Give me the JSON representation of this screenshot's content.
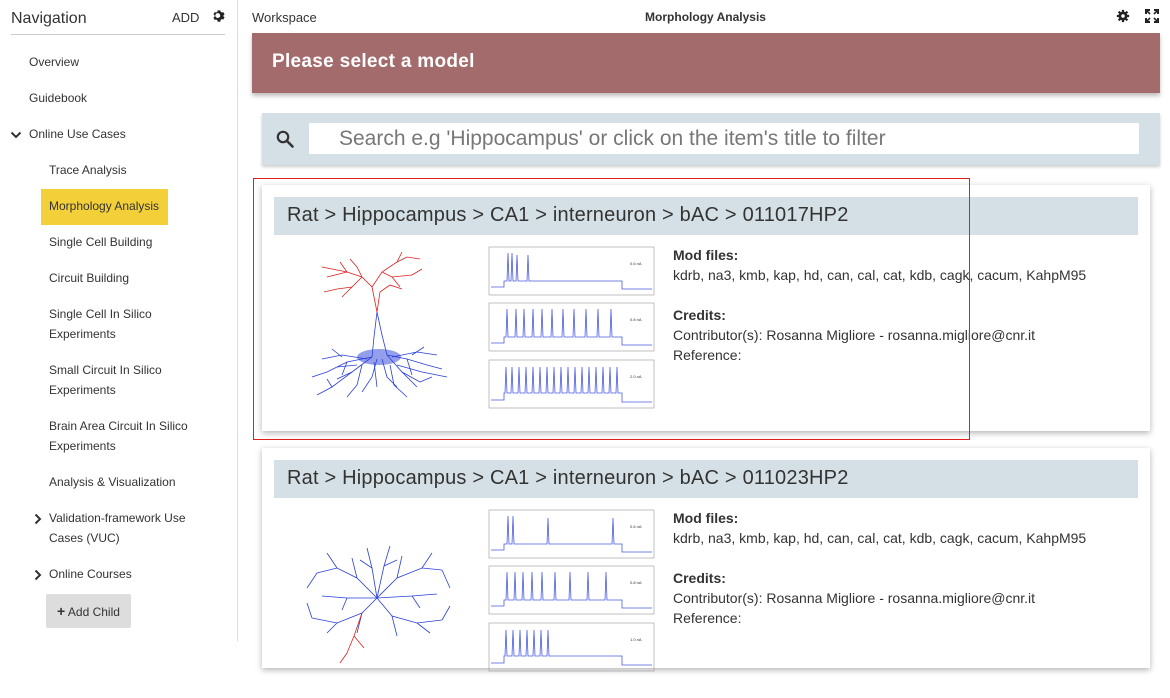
{
  "sidebar": {
    "title": "Navigation",
    "add_label": "ADD",
    "items": [
      {
        "label": "Overview"
      },
      {
        "label": "Guidebook"
      },
      {
        "label": "Online Use Cases"
      },
      {
        "label": "Trace Analysis"
      },
      {
        "label": "Morphology Analysis"
      },
      {
        "label": "Single Cell Building"
      },
      {
        "label": "Circuit Building"
      },
      {
        "label": "Single Cell In Silico Experiments"
      },
      {
        "label": "Small Circuit In Silico Experiments"
      },
      {
        "label": "Brain Area Circuit In Silico Experiments"
      },
      {
        "label": "Analysis & Visualization"
      },
      {
        "label": "Validation-framework Use Cases (VUC)"
      },
      {
        "label": "Online Courses"
      }
    ],
    "add_child_label": "Add Child"
  },
  "workspace": {
    "label": "Workspace",
    "title": "Morphology Analysis"
  },
  "banner": {
    "text": "Please select a model"
  },
  "search": {
    "placeholder": "Search e.g 'Hippocampus' or click on the item's title to filter"
  },
  "cards": [
    {
      "title": "Rat  >  Hippocampus  >  CA1  >  interneuron  >  bAC  >  011017HP2",
      "mod_files_label": "Mod files:",
      "mod_files": "kdrb, na3, kmb, kap, hd, can, cal, cat, kdb, cagk, cacum, KahpM95",
      "credits_label": "Credits:",
      "contributor": "Contributor(s): Rosanna Migliore - rosanna.migliore@cnr.it",
      "reference": "Reference:",
      "traces": [
        "0.6 nA",
        "0.8 nA",
        "2.0 nA"
      ]
    },
    {
      "title": "Rat  >  Hippocampus  >  CA1  >  interneuron  >  bAC  >  011023HP2",
      "mod_files_label": "Mod files:",
      "mod_files": "kdrb, na3, kmb, kap, hd, can, cal, cat, kdb, cagk, cacum, KahpM95",
      "credits_label": "Credits:",
      "contributor": "Contributor(s): Rosanna Migliore - rosanna.migliore@cnr.it",
      "reference": "Reference:",
      "traces": [
        "0.6 nA",
        "0.8 nA",
        "1.0 nA"
      ]
    }
  ],
  "colors": {
    "selected": "#f3d03a",
    "banner": "#a46b6c",
    "panel": "#d4e0e5",
    "highlight": "#e0201e"
  }
}
